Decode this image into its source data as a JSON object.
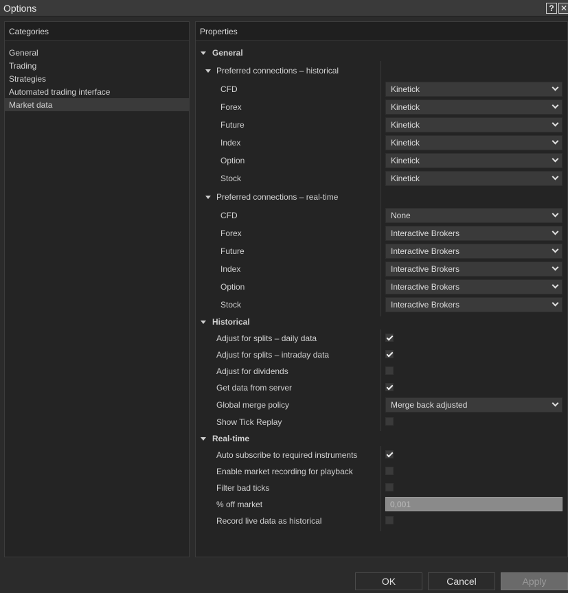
{
  "window": {
    "title": "Options",
    "help_label": "?",
    "close_label": "✕"
  },
  "categories": {
    "header": "Categories",
    "items": [
      "General",
      "Trading",
      "Strategies",
      "Automated trading interface",
      "Market data"
    ],
    "selected_index": 4
  },
  "properties": {
    "header": "Properties",
    "general": {
      "title": "General",
      "historical_group": {
        "title": "Preferred connections – historical",
        "rows": [
          {
            "label": "CFD",
            "value": "Kinetick"
          },
          {
            "label": "Forex",
            "value": "Kinetick"
          },
          {
            "label": "Future",
            "value": "Kinetick"
          },
          {
            "label": "Index",
            "value": "Kinetick"
          },
          {
            "label": "Option",
            "value": "Kinetick"
          },
          {
            "label": "Stock",
            "value": "Kinetick"
          }
        ]
      },
      "realtime_group": {
        "title": "Preferred connections – real-time",
        "rows": [
          {
            "label": "CFD",
            "value": "None"
          },
          {
            "label": "Forex",
            "value": "Interactive Brokers"
          },
          {
            "label": "Future",
            "value": "Interactive Brokers"
          },
          {
            "label": "Index",
            "value": "Interactive Brokers"
          },
          {
            "label": "Option",
            "value": "Interactive Brokers"
          },
          {
            "label": "Stock",
            "value": "Interactive Brokers"
          }
        ]
      }
    },
    "historical": {
      "title": "Historical",
      "adjust_splits_daily": {
        "label": "Adjust for splits – daily data",
        "checked": true
      },
      "adjust_splits_intraday": {
        "label": "Adjust for splits – intraday data",
        "checked": true
      },
      "adjust_dividends": {
        "label": "Adjust for dividends",
        "checked": false
      },
      "get_data_from_server": {
        "label": "Get data from server",
        "checked": true
      },
      "global_merge_policy": {
        "label": "Global merge policy",
        "value": "Merge back adjusted"
      },
      "show_tick_replay": {
        "label": "Show Tick Replay",
        "checked": false
      }
    },
    "realtime": {
      "title": "Real-time",
      "auto_subscribe": {
        "label": "Auto subscribe to required instruments",
        "checked": true
      },
      "enable_market_recording": {
        "label": "Enable market recording for playback",
        "checked": false
      },
      "filter_bad_ticks": {
        "label": "Filter bad ticks",
        "checked": false
      },
      "pct_off_market": {
        "label": "% off market",
        "value": "0,001"
      },
      "record_live_data": {
        "label": "Record live data as historical",
        "checked": false
      }
    }
  },
  "buttons": {
    "ok": "OK",
    "cancel": "Cancel",
    "apply": "Apply"
  }
}
